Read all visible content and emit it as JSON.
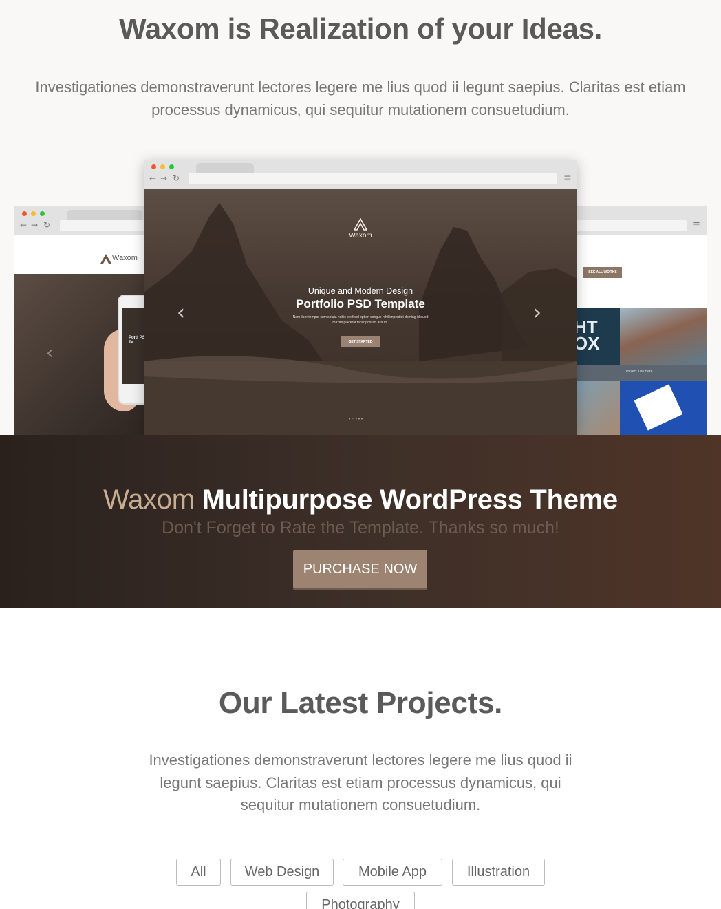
{
  "hero": {
    "title": "Waxom is Realization of your Ideas.",
    "description": "Investigationes demonstraverunt lectores legere me lius quod ii legunt saepius. Claritas est etiam processus dynamicus, qui sequitur mutationem consuetudium."
  },
  "mockup_center": {
    "brand": "Waxom",
    "subtitle": "Unique and Modern Design",
    "title": "Portfolio PSD Template",
    "text": "Nam liber tempor cum soluta nobis eleifend option congue nihil imperdiet doming id quod mazim placerat facer possim assum.",
    "button": "GET STARTED",
    "prev_arrow": "‹",
    "next_arrow": "›",
    "dots": "•○•••"
  },
  "mockup_left": {
    "brand": "Waxom",
    "phone_title": "Portf PSD Te"
  },
  "mockup_right": {
    "see_all": "SEE ALL WORKS",
    "tile_caption": "Project Title Here",
    "tile_text": "HT OX"
  },
  "cta": {
    "brand": "Waxom",
    "title": "Multipurpose WordPress Theme",
    "subtitle": "Don't Forget to Rate the Template. Thanks so much!",
    "button": "PURCHASE NOW"
  },
  "projects": {
    "title": "Our Latest Projects.",
    "description": "Investigationes demonstraverunt lectores legere me lius quod ii legunt saepius. Claritas est etiam processus dynamicus, qui sequitur mutationem consuetudium.",
    "filters": [
      "All",
      "Web Design",
      "Mobile App",
      "Illustration",
      "Photography"
    ]
  },
  "colors": {
    "accent": "#9d8472",
    "brand_tan": "#c9ad92",
    "dark_band": "#2a211d"
  }
}
